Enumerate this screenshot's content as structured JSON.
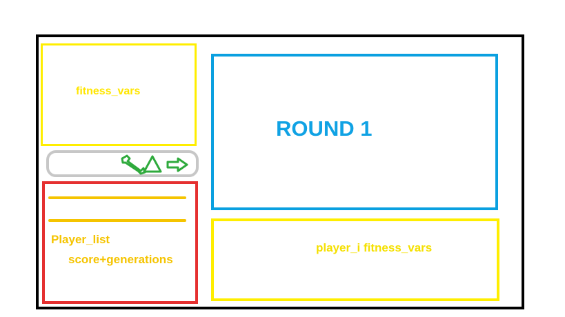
{
  "panels": {
    "fitness": {
      "label": "fitness_vars"
    },
    "round": {
      "label": "ROUND 1"
    },
    "player_list": {
      "title": "Player_list",
      "subtitle": "score+generations"
    },
    "player_fitness": {
      "label": "player_i fitness_vars"
    }
  },
  "controls": {
    "icons": [
      "wrench-icon",
      "triangle-icon",
      "arrow-right-icon"
    ]
  },
  "colors": {
    "frame": "#000000",
    "yellow": "#ffee00",
    "blue": "#0aa0e0",
    "red": "#e53030",
    "gray": "#c7c7c7",
    "green": "#2eaa3c",
    "label_yellow": "#f5c400"
  }
}
